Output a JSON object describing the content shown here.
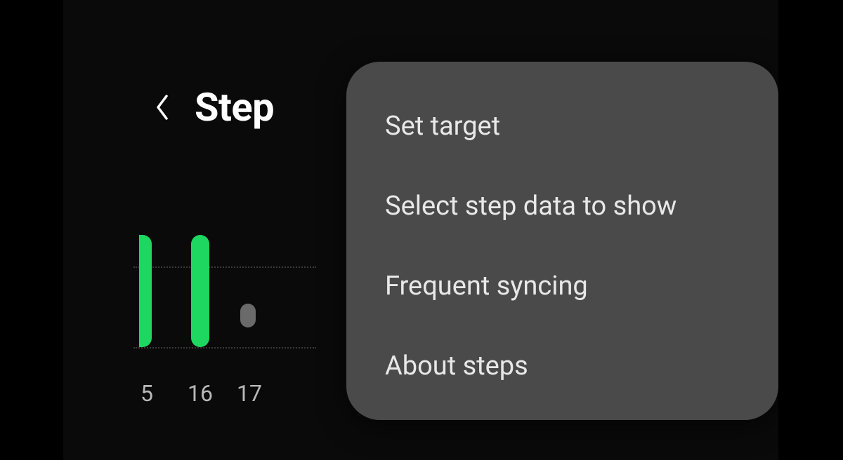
{
  "header": {
    "title": "Step"
  },
  "chart_data": {
    "type": "bar",
    "categories": [
      "5",
      "16",
      "17"
    ],
    "values": [
      100,
      100,
      20
    ],
    "title": "",
    "xlabel": "",
    "ylabel": "",
    "colors": {
      "active": "#1ed760",
      "inactive": "#6a6a6a"
    }
  },
  "menu": {
    "items": [
      {
        "label": "Set target"
      },
      {
        "label": "Select step data to show"
      },
      {
        "label": "Frequent syncing"
      },
      {
        "label": "About steps"
      }
    ]
  }
}
